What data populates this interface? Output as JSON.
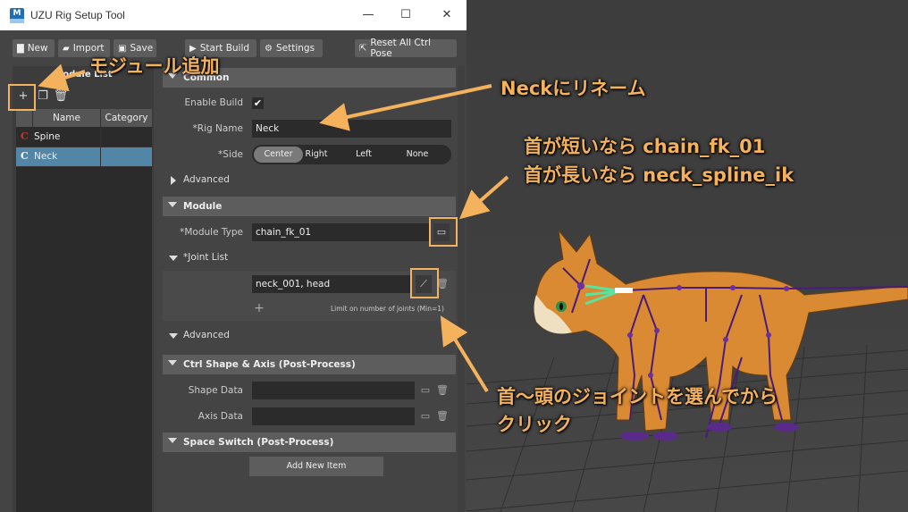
{
  "window": {
    "icon_text": "M",
    "title": "UZU Rig Setup Tool",
    "controls": {
      "minimize": "—",
      "maximize": "☐",
      "close": "✕"
    }
  },
  "toolbar": {
    "new_label": "New",
    "import_label": "Import",
    "save_label": "Save",
    "start_build_label": "Start Build",
    "settings_label": "Settings",
    "reset_label": "Reset All Ctrl Pose"
  },
  "module_list": {
    "title": "Module List",
    "columns": {
      "name": "Name",
      "category": "Category"
    },
    "rows": [
      {
        "tag": "C",
        "name": "Spine",
        "category": "",
        "selected": false
      },
      {
        "tag": "C",
        "name": "Neck",
        "category": "",
        "selected": true
      }
    ]
  },
  "common": {
    "header": "Common",
    "enable_build_label": "Enable Build",
    "enable_build_checked": "✔",
    "rig_name_label": "*Rig Name",
    "rig_name_value": "Neck",
    "side_label": "*Side",
    "side_options": [
      "Center",
      "Right",
      "Left",
      "None"
    ],
    "side_selected": "Center",
    "advanced_label": "Advanced"
  },
  "module": {
    "header": "Module",
    "module_type_label": "*Module Type",
    "module_type_value": "chain_fk_01",
    "joint_list_label": "*Joint List",
    "joint_value": "neck_001, head",
    "limit_text": "Limit on number of joints (Min=1)",
    "advanced_label": "Advanced"
  },
  "ctrl_shape": {
    "header": "Ctrl Shape & Axis (Post-Process)",
    "shape_data_label": "Shape Data",
    "axis_data_label": "Axis Data"
  },
  "space_switch": {
    "header": "Space Switch (Post-Process)",
    "add_item_label": "Add New Item"
  },
  "annotations": {
    "add_module": "モジュール追加",
    "rename": "Neckにリネーム",
    "type_hint_line1": "首が短いなら chain_fk_01",
    "type_hint_line2": "首が長いなら neck_spline_ik",
    "joint_hint_line1": "首～頭のジョイントを選んでから",
    "joint_hint_line2": "クリック"
  },
  "colors": {
    "annotation": "#f5b25d",
    "selection": "#5285a6",
    "module_tag": "#c0392b"
  }
}
